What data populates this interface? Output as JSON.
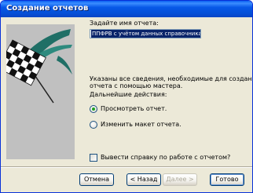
{
  "window": {
    "title": "Создание отчетов"
  },
  "art": {
    "description_icon": "checkered-flag-icon"
  },
  "name_prompt": {
    "label": "Задайте имя отчета:",
    "value": "ППФРВ с учётом данных справочника"
  },
  "info": {
    "line1": "Указаны все сведения, необходимые для создания",
    "line2": "отчета с помощью мастера.",
    "next_actions": "Дальнейшие действия:"
  },
  "options": [
    {
      "label": "Просмотреть отчет.",
      "selected": true
    },
    {
      "label": "Изменить макет отчета.",
      "selected": false
    }
  ],
  "help_checkbox": {
    "label": "Вывести справку по работе с отчетом?",
    "checked": false
  },
  "buttons": {
    "cancel": "Отмена",
    "back": "< Назад",
    "next": "Далее >",
    "finish": "Готово"
  }
}
